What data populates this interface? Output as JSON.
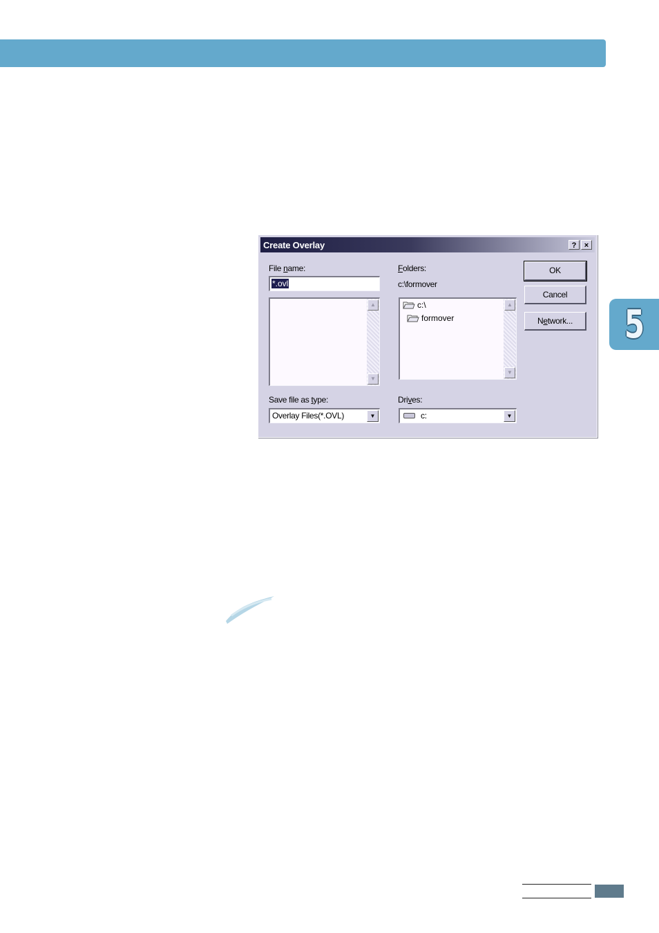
{
  "dialog": {
    "title": "Create Overlay",
    "help_button": "?",
    "close_button": "×",
    "file_name": {
      "label_pre": "File ",
      "label_underlined": "n",
      "label_post": "ame:",
      "value": "*.ovl"
    },
    "file_list": [],
    "folders": {
      "label_underlined": "F",
      "label_post": "olders:",
      "current_path": "c:\\formover",
      "items": [
        "c:\\",
        "formover"
      ]
    },
    "save_type": {
      "label_pre": "Save file as ",
      "label_underlined": "t",
      "label_post": "ype:",
      "value": "Overlay Files(*.OVL)"
    },
    "drives": {
      "label_pre": "Dri",
      "label_underlined": "v",
      "label_post": "es:",
      "value": "c:"
    },
    "buttons": {
      "ok": "OK",
      "cancel": "Cancel",
      "network_pre": "N",
      "network_underlined": "e",
      "network_post": "twork..."
    }
  },
  "chapter": {
    "number": "5"
  },
  "colors": {
    "accent": "#64a9cc",
    "dialog_face": "#d5d3e5",
    "title_bar": "#1e1e44",
    "footer_box": "#5f7b8c"
  }
}
